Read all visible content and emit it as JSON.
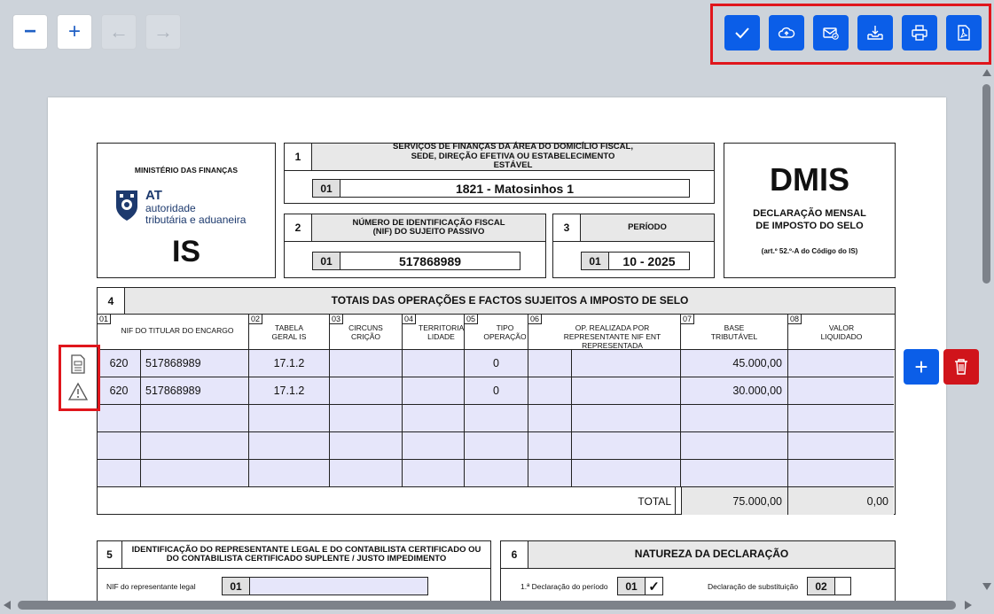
{
  "toolbar": {
    "zoom_out": "−",
    "zoom_in": "+",
    "back": "←",
    "forward": "→"
  },
  "actions": [
    "confirm-icon",
    "cloud-upload-icon",
    "envelope-check-icon",
    "download-tray-icon",
    "printer-icon",
    "pdf-icon"
  ],
  "form": {
    "ministry": "MINISTÉRIO DAS FINANÇAS",
    "at_short": "AT",
    "at_line1": "autoridade",
    "at_line2": "tributária e aduaneira",
    "is": "IS",
    "q1_num": "1",
    "q1_title": "SERVIÇOS DE FINANÇAS DA ÁREA DO DOMICÍLIO FISCAL, SEDE, DIREÇÃO EFETIVA OU ESTABELECIMENTO ESTÁVEL",
    "q1_lbl": "01",
    "q1_val": "1821 - Matosinhos 1",
    "q2_num": "2",
    "q2_title": "NÚMERO DE IDENTIFICAÇÃO FISCAL (NIF) DO SUJEITO PASSIVO",
    "q2_lbl": "01",
    "q2_val": "517868989",
    "q3_num": "3",
    "q3_title": "PERÍODO",
    "q3_lbl": "01",
    "q3_val": "10 - 2025",
    "dmis": "DMIS",
    "dmis_sub": "DECLARAÇÃO MENSAL DE IMPOSTO DO SELO",
    "dmis_art": "(art.º 52.º-A do Código do IS)",
    "q4_num": "4",
    "q4_title": "TOTAIS DAS OPERAÇÕES E FACTOS SUJEITOS A IMPOSTO DE SELO",
    "cols": [
      {
        "n": "01",
        "t": "NIF DO TITULAR DO ENCARGO"
      },
      {
        "n": "02",
        "t": "TABELA GERAL IS"
      },
      {
        "n": "03",
        "t": "CIRCUNS CRIÇÃO"
      },
      {
        "n": "04",
        "t": "TERRITORIA LIDADE"
      },
      {
        "n": "05",
        "t": "TIPO OPERAÇÃO"
      },
      {
        "n": "06",
        "t": "OP. REALIZADA POR REPRESENTANTE NIF ENT REPRESENTADA"
      },
      {
        "n": "07",
        "t": "BASE TRIBUTÁVEL"
      },
      {
        "n": "08",
        "t": "VALOR LIQUIDADO"
      }
    ],
    "rows": [
      {
        "code": "620",
        "nif": "517868989",
        "tabela": "17.1.2",
        "tipo": "0",
        "base": "45.000,00"
      },
      {
        "code": "620",
        "nif": "517868989",
        "tabela": "17.1.2",
        "tipo": "0",
        "base": "30.000,00"
      }
    ],
    "total_label": "TOTAL",
    "total_base": "75.000,00",
    "total_valor": "0,00",
    "q5_num": "5",
    "q5_title": "IDENTIFICAÇÃO DO REPRESENTANTE LEGAL E DO CONTABILISTA CERTIFICADO OU DO CONTABILISTA CERTIFICADO SUPLENTE / JUSTO IMPEDIMENTO",
    "q5_field": "NIF do representante legal",
    "q5_lbl": "01",
    "q6_num": "6",
    "q6_title": "NATUREZA DA DECLARAÇÃO",
    "q6_first": "1.ª Declaração do período",
    "q6_first_lbl": "01",
    "q6_first_val": "✓",
    "q6_sub": "Declaração de substituição",
    "q6_sub_lbl": "02"
  },
  "side": {
    "add": "+",
    "delete": "delete-icon"
  },
  "colors": {
    "accent": "#0b5ee8",
    "danger": "#d0141b",
    "highlight": "#e0161c",
    "row_fill": "#e6e6fa"
  }
}
